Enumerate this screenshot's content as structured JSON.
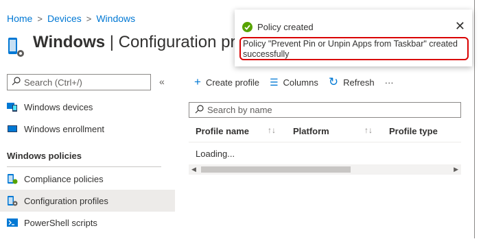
{
  "breadcrumb": [
    "Home",
    "Devices",
    "Windows"
  ],
  "page": {
    "title_bold": "Windows",
    "title_rest": " | Configuration pr"
  },
  "sidebar": {
    "search_placeholder": "Search (Ctrl+/)",
    "collapse_glyph": "«",
    "top_items": [
      {
        "label": "Windows devices",
        "icon": "windows-devices-icon"
      },
      {
        "label": "Windows enrollment",
        "icon": "windows-enrollment-icon"
      }
    ],
    "section_title": "Windows policies",
    "policy_items": [
      {
        "label": "Compliance policies",
        "icon": "compliance-icon",
        "active": false
      },
      {
        "label": "Configuration profiles",
        "icon": "configuration-icon",
        "active": true
      },
      {
        "label": "PowerShell scripts",
        "icon": "powershell-icon",
        "active": false
      }
    ]
  },
  "toolbar": {
    "create_label": "Create profile",
    "columns_label": "Columns",
    "refresh_label": "Refresh",
    "more_label": "···"
  },
  "grid": {
    "search_placeholder": "Search by name",
    "columns": [
      "Profile name",
      "Platform",
      "Profile type"
    ],
    "loading_text": "Loading..."
  },
  "toast": {
    "title": "Policy created",
    "message": "Policy \"Prevent Pin or Unpin Apps from Taskbar\" created successfully",
    "highlight_color": "#d90000",
    "status_color": "#57a300"
  },
  "colors": {
    "accent": "#0078d4",
    "active_bg": "#edebe9"
  }
}
